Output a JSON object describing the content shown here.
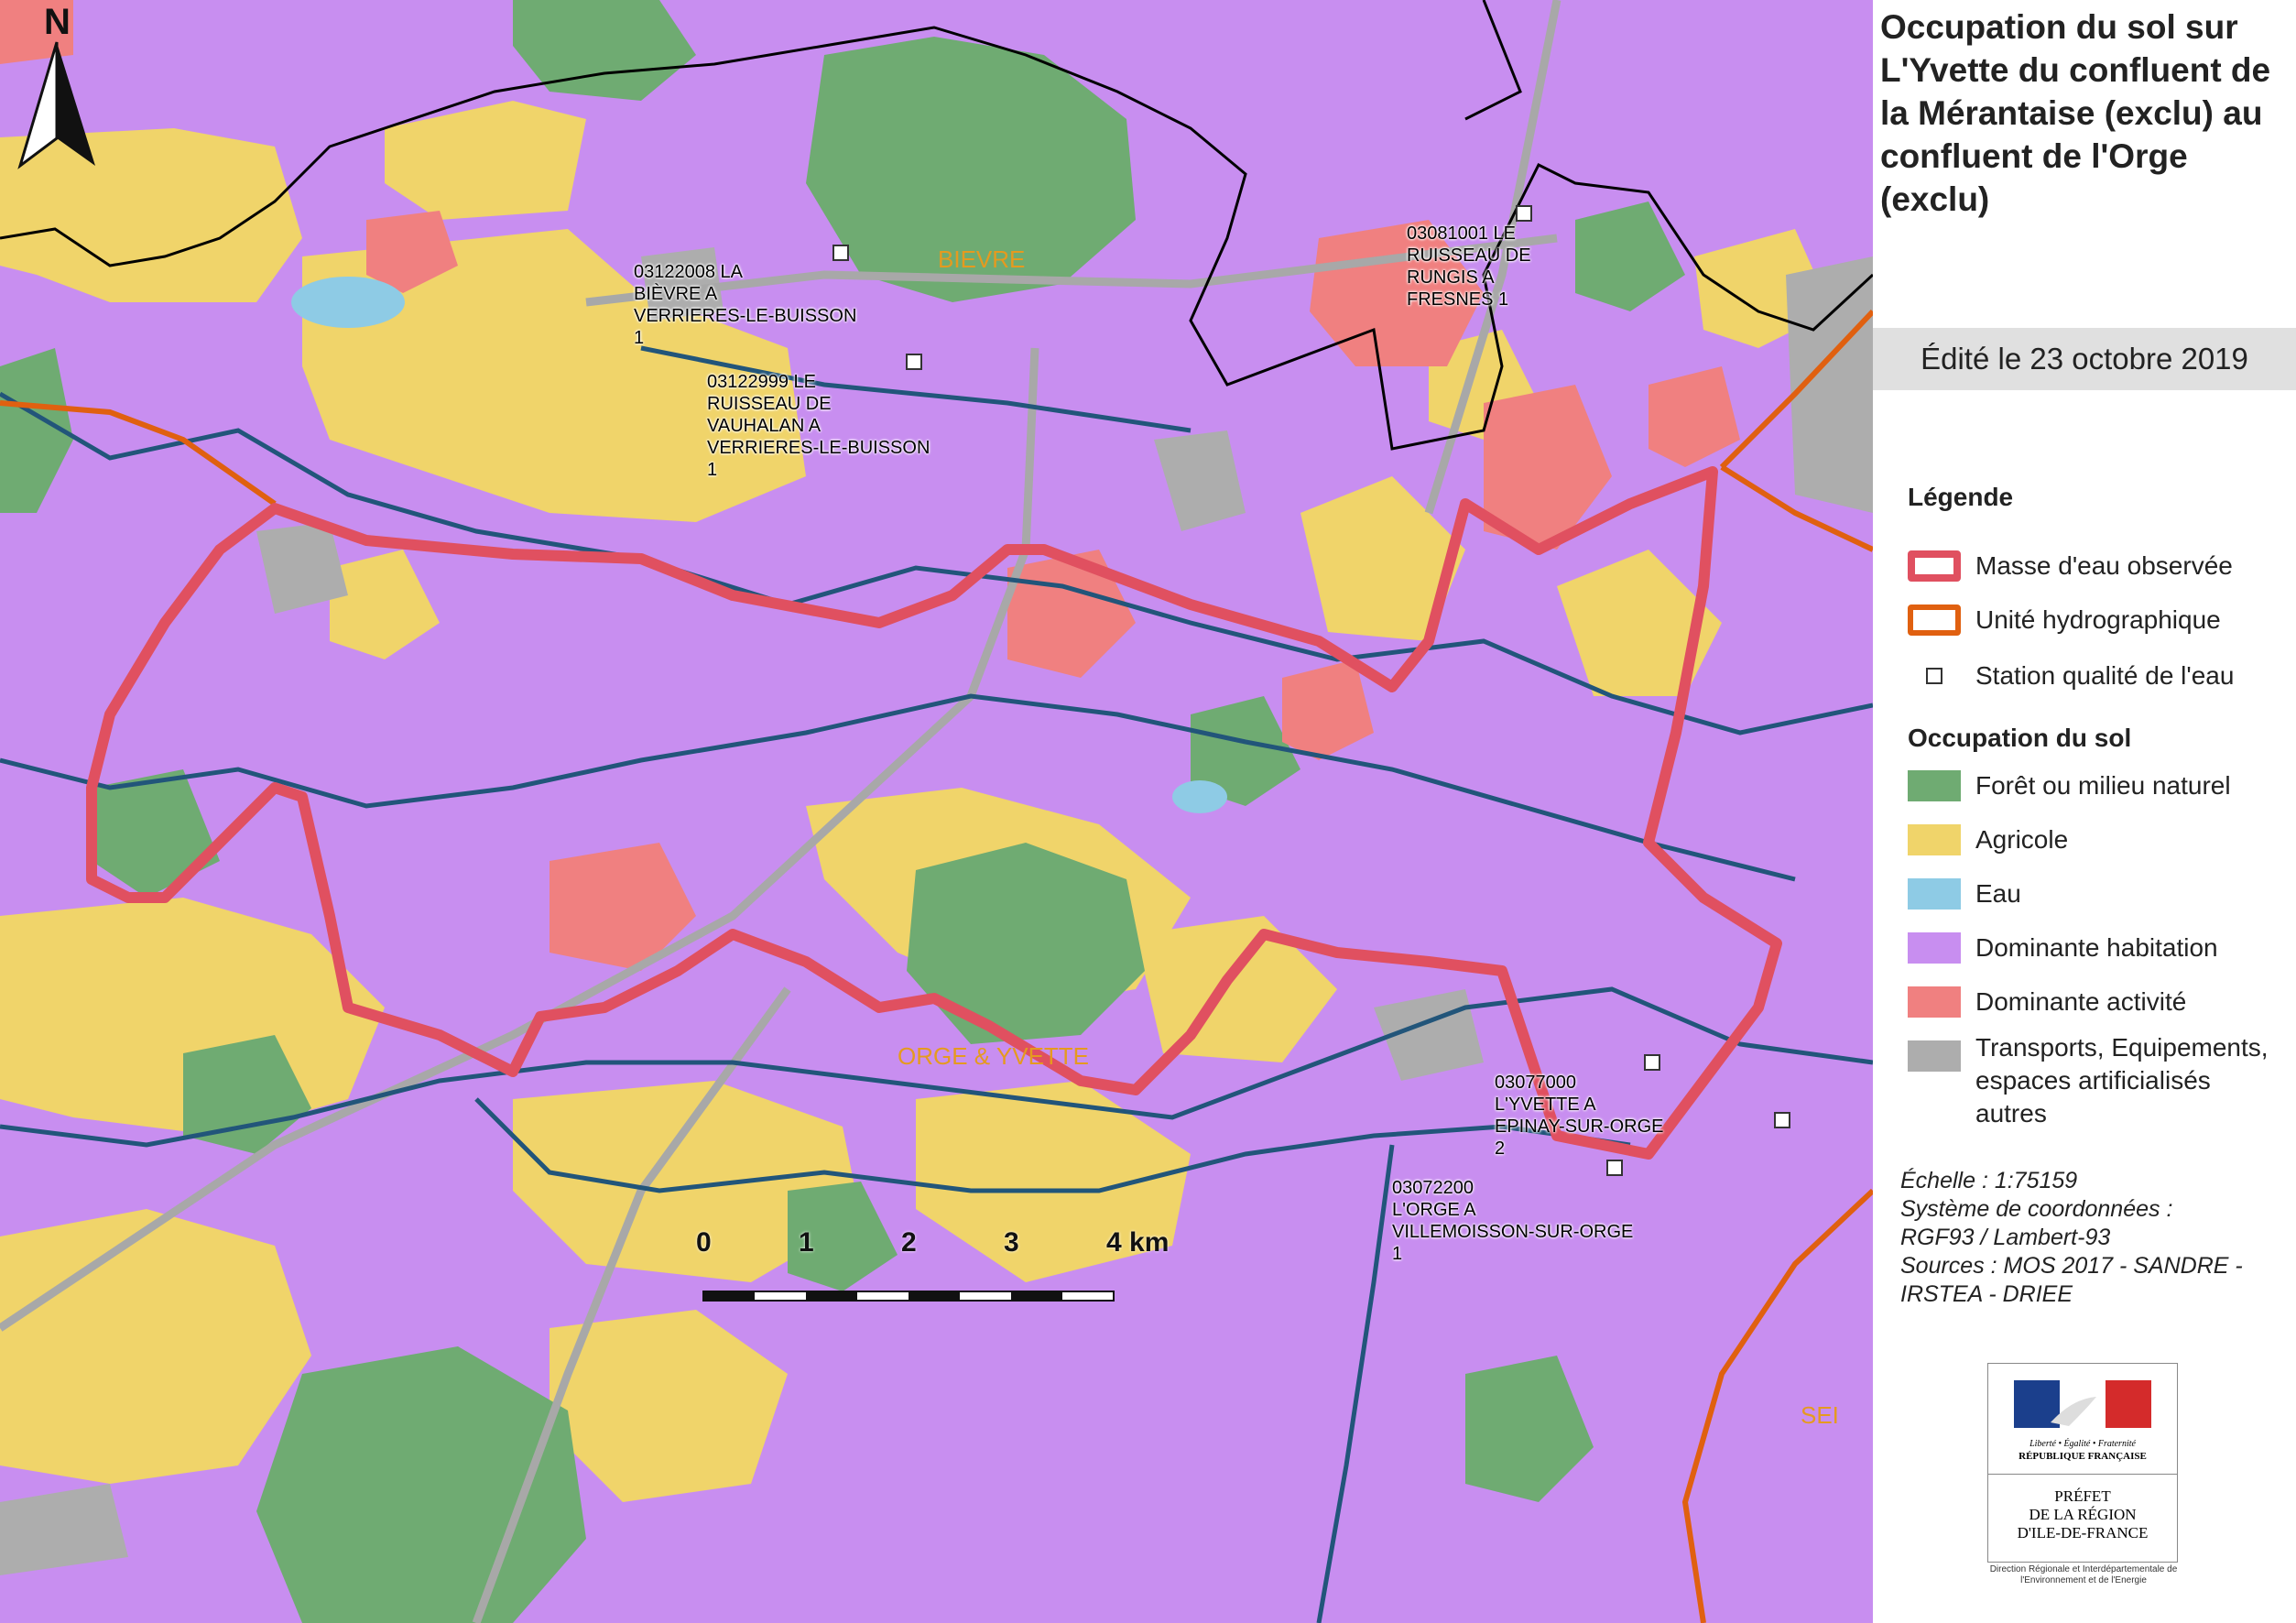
{
  "title": "Occupation du sol sur L'Yvette du confluent de la Mérantaise (exclu) au confluent de l'Orge (exclu)",
  "edition": "Édité le 23 octobre 2019",
  "legend": {
    "heading": "Légende",
    "items": [
      {
        "label": "Masse d'eau observée",
        "color": "#e05060"
      },
      {
        "label": "Unité hydrographique",
        "color": "#e06010"
      },
      {
        "label": "Station qualité de l'eau",
        "color": "#ffffff"
      }
    ],
    "landuse_heading": "Occupation du sol",
    "landuse": [
      {
        "label": "Forêt ou milieu naturel",
        "color": "#6fab72"
      },
      {
        "label": "Agricole",
        "color": "#f0d46a"
      },
      {
        "label": "Eau",
        "color": "#8ecbe5"
      },
      {
        "label": "Dominante habitation",
        "color": "#c88ef0"
      },
      {
        "label": "Dominante activité",
        "color": "#f08080"
      },
      {
        "label": "Transports, Equipements, espaces artificialisés autres",
        "color": "#adadad"
      }
    ]
  },
  "meta": {
    "scale": "Échelle :  1:75159",
    "crs": "Système de coordonnées : RGF93 / Lambert-93",
    "sources": "Sources : MOS 2017 - SANDRE - IRSTEA - DRIEE"
  },
  "logo": {
    "motto": "Liberté • Égalité • Fraternité",
    "republic": "RÉPUBLIQUE FRANÇAISE",
    "prefet": "PRÉFET\nDE LA RÉGION\nD'ILE-DE-FRANCE",
    "caption": "Direction Régionale et Interdépartementale de l'Environnement et de l'Energie"
  },
  "north": "N",
  "scale_bar": {
    "ticks": [
      "0",
      "1",
      "2",
      "3",
      "4 km"
    ]
  },
  "stations": [
    {
      "label": "03122008   LA\nBIÈVRE A\nVERRIERES-LE-BUISSON\n1"
    },
    {
      "label": "03122999   LE\nRUISSEAU DE\nVAUHALAN A\nVERRIERES-LE-BUISSON\n1"
    },
    {
      "label": "03081001   LE\nRUISSEAU DE\nRUNGIS A\nFRESNES  1"
    },
    {
      "label": "03077000\nL'YVETTE A\nEPINAY-SUR-ORGE\n2"
    },
    {
      "label": "03072200\nL'ORGE A\nVILLEMOISSON-SUR-ORGE\n1"
    }
  ],
  "zones": [
    "BIEVRE",
    "ORGE & YVETTE",
    "SEI"
  ],
  "colors": {
    "river": "#22557a",
    "boundary": "#000000",
    "water_body": "#e05060",
    "hydro_unit": "#e06010"
  }
}
